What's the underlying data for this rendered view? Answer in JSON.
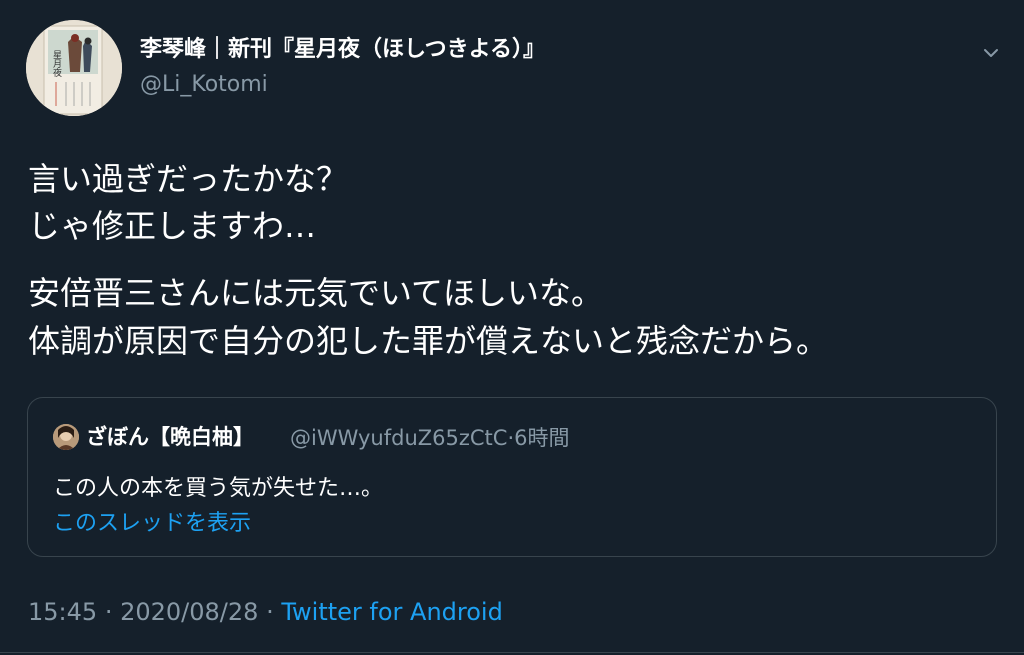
{
  "author": {
    "display_name": "李琴峰｜新刊『星月夜（ほしつきよる）』",
    "handle": "@Li_Kotomi"
  },
  "tweet": {
    "lines_block1": [
      "言い過ぎだったかな？",
      "じゃ修正しますわ…"
    ],
    "lines_block2": [
      "安倍晋三さんには元気でいてほしいな。",
      "体調が原因で自分の犯した罪が償えないと残念だから。"
    ]
  },
  "quoted": {
    "display_name": "ざぼん【晩白柚】",
    "handle": "@iWWyufduZ65zCtC",
    "separator": "·",
    "time": "6時間",
    "text": "この人の本を買う気が失せた…。",
    "thread_link": "このスレッドを表示"
  },
  "footer": {
    "time": "15:45",
    "separator": "·",
    "date": "2020/08/28",
    "source": "Twitter for Android"
  },
  "avatar_book_title": "星月夜",
  "colors": {
    "background": "#15202b",
    "text_primary": "#ffffff",
    "text_secondary": "#8899a6",
    "link": "#1da1f2",
    "border": "#38444d"
  },
  "icons": {
    "menu": "chevron-down-icon"
  }
}
